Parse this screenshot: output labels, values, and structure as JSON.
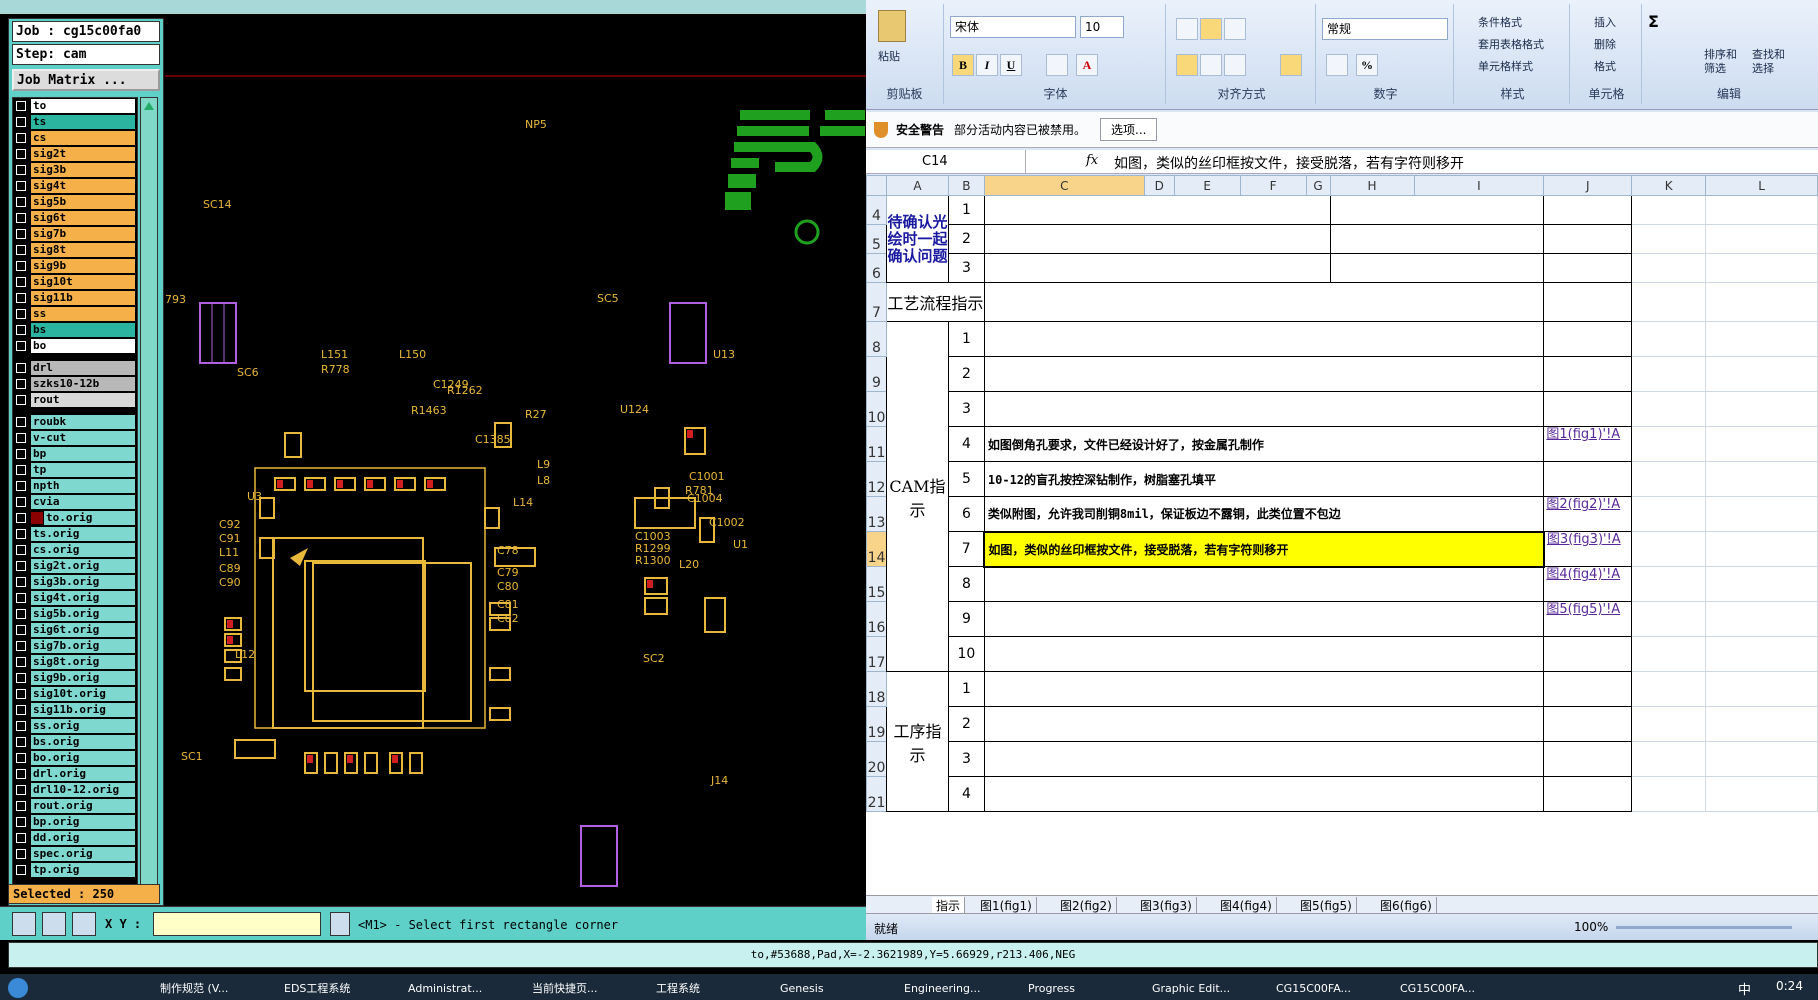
{
  "cam": {
    "job_label": "Job : cg15c00fa0",
    "step_label": "Step: cam",
    "job_matrix": "Job Matrix ...",
    "selected": "Selected : 250",
    "xy_label": "X Y :",
    "prompt": "<M1> - Select first rectangle corner",
    "status": "to,#53688,Pad,X=-2.3621989,Y=5.66929,r213.406,NEG",
    "layers": [
      {
        "name": "to",
        "color": "#ffffff"
      },
      {
        "name": "ts",
        "color": "#2bb5a0"
      },
      {
        "name": "cs",
        "color": "#f5b04a"
      },
      {
        "name": "sig2t",
        "color": "#f5b04a"
      },
      {
        "name": "sig3b",
        "color": "#f5b04a"
      },
      {
        "name": "sig4t",
        "color": "#f5b04a"
      },
      {
        "name": "sig5b",
        "color": "#f5b04a"
      },
      {
        "name": "sig6t",
        "color": "#f5b04a"
      },
      {
        "name": "sig7b",
        "color": "#f5b04a"
      },
      {
        "name": "sig8t",
        "color": "#f5b04a"
      },
      {
        "name": "sig9b",
        "color": "#f5b04a"
      },
      {
        "name": "sig10t",
        "color": "#f5b04a"
      },
      {
        "name": "sig11b",
        "color": "#f5b04a"
      },
      {
        "name": "ss",
        "color": "#f5b04a"
      },
      {
        "name": "bs",
        "color": "#2bb5a0"
      },
      {
        "name": "bo",
        "color": "#ffffff"
      }
    ],
    "drill_layers": [
      {
        "name": "drl",
        "color": "#b8b8b8"
      },
      {
        "name": "szks10-12b",
        "color": "#b8b8b8"
      },
      {
        "name": "rout",
        "color": "#d8d8d8"
      }
    ],
    "misc_layers": [
      "roubk",
      "v-cut",
      "bp",
      "tp",
      "npth",
      "cvia",
      "to.orig",
      "ts.orig",
      "cs.orig",
      "sig2t.orig",
      "sig3b.orig",
      "sig4t.orig",
      "sig5b.orig",
      "sig6t.orig",
      "sig7b.orig",
      "sig8t.orig",
      "sig9b.orig",
      "sig10t.orig",
      "sig11b.orig",
      "ss.orig",
      "bs.orig",
      "bo.orig",
      "drl.orig",
      "drl10-12.orig",
      "rout.orig",
      "bp.orig",
      "dd.orig",
      "spec.orig",
      "tp.orig"
    ],
    "misc_color": "#7fd8d0",
    "pcb_labels": [
      "NP5",
      "SC14",
      "SC5",
      "SC6",
      "U3",
      "SC2",
      "SC1",
      "L12",
      "L14",
      "L151",
      "L150",
      "U13",
      "U124",
      "L9",
      "L8",
      "C1385",
      "R778",
      "R1463",
      "C1249",
      "R1262",
      "C1003",
      "R1299",
      "R1300",
      "L20",
      "C1002",
      "R27",
      "C92",
      "C91",
      "L11",
      "C89",
      "C90",
      "C79",
      "C80",
      "C81",
      "C82",
      "C78",
      "C1001",
      "R781",
      "C1004",
      "J14",
      "793",
      "U1"
    ]
  },
  "excel": {
    "clipboard": {
      "paste": "粘贴",
      "group": "剪贴板"
    },
    "font": {
      "name": "宋体",
      "size": "10",
      "group": "字体"
    },
    "align": {
      "group": "对齐方式"
    },
    "number": {
      "format": "常规",
      "group": "数字"
    },
    "styles": {
      "cond": "条件格式",
      "table": "套用表格格式",
      "cell": "单元格样式",
      "group": "样式"
    },
    "cells": {
      "insert": "插入",
      "delete": "删除",
      "format": "格式",
      "group": "单元格"
    },
    "edit": {
      "sort": "排序和\n筛选",
      "find": "查找和\n选择",
      "group": "编辑"
    },
    "security": {
      "title": "安全警告",
      "text": "部分活动内容已被禁用。",
      "button": "选项..."
    },
    "namebox": "C14",
    "fx": "fx",
    "formula": "如图，类似的丝印框按文件，接受脱落，若有字符则移开",
    "columns": [
      "A",
      "B",
      "C",
      "D",
      "E",
      "F",
      "G",
      "H",
      "I",
      "J",
      "K",
      "L"
    ],
    "cat_pending": "待确认光绘时一起确认问题",
    "cat_process": "工艺流程指示",
    "cat_cam": "CAM指示",
    "cat_step": "工序指示",
    "rows": [
      {
        "r": "4",
        "b": "1",
        "c": "",
        "j": ""
      },
      {
        "r": "5",
        "b": "2",
        "c": "",
        "j": ""
      },
      {
        "r": "6",
        "b": "3",
        "c": "",
        "j": ""
      },
      {
        "r": "7",
        "b": "",
        "c": "",
        "j": ""
      },
      {
        "r": "8",
        "b": "1",
        "c": "",
        "j": ""
      },
      {
        "r": "9",
        "b": "2",
        "c": "",
        "j": ""
      },
      {
        "r": "10",
        "b": "3",
        "c": "",
        "j": ""
      },
      {
        "r": "11",
        "b": "4",
        "c": "如图倒角孔要求，文件已经设计好了，按金属孔制作",
        "j": "图1(fig1)'!A"
      },
      {
        "r": "12",
        "b": "5",
        "c": "10-12的盲孔按控深钻制作，树脂塞孔填平",
        "j": ""
      },
      {
        "r": "13",
        "b": "6",
        "c": "类似附图，允许我司削铜8mil，保证板边不露铜，此类位置不包边",
        "j": "图2(fig2)'!A"
      },
      {
        "r": "14",
        "b": "7",
        "c": "如图，类似的丝印框按文件，接受脱落，若有字符则移开",
        "j": "图3(fig3)'!A"
      },
      {
        "r": "15",
        "b": "8",
        "c": "",
        "j": "图4(fig4)'!A"
      },
      {
        "r": "16",
        "b": "9",
        "c": "",
        "j": "图5(fig5)'!A"
      },
      {
        "r": "17",
        "b": "10",
        "c": "",
        "j": ""
      },
      {
        "r": "18",
        "b": "1",
        "c": "",
        "j": ""
      },
      {
        "r": "19",
        "b": "2",
        "c": "",
        "j": ""
      },
      {
        "r": "20",
        "b": "3",
        "c": "",
        "j": ""
      },
      {
        "r": "21",
        "b": "4",
        "c": "",
        "j": ""
      }
    ],
    "sheet_tabs": [
      "指示",
      "图1(fig1)",
      "图2(fig2)",
      "图3(fig3)",
      "图4(fig4)",
      "图5(fig5)",
      "图6(fig6)"
    ],
    "status": "就绪",
    "zoom": "100%"
  },
  "taskbar": {
    "items": [
      "制作规范 (V...",
      "EDS工程系统",
      "Administrat...",
      "当前快捷页...",
      "工程系统",
      "Genesis",
      "Engineering...",
      "Progress",
      "Graphic Edit...",
      "CG15C00FA...",
      "CG15C00FA..."
    ],
    "ime": "中",
    "clock": "0:24"
  }
}
